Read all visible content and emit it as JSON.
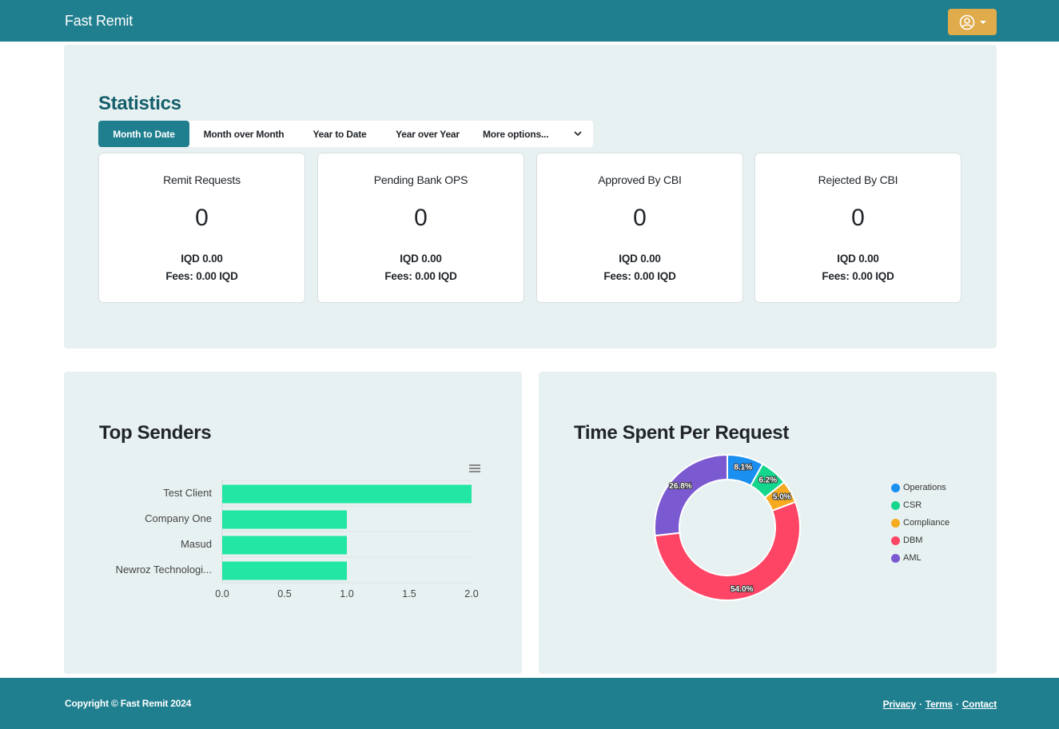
{
  "navbar": {
    "brand": "Fast Remit",
    "user_menu_icon": "user-circle-icon",
    "accent_color": "#1f7f8f",
    "button_color": "#dfab4b"
  },
  "statistics": {
    "title": "Statistics",
    "tabs": [
      {
        "label": "Month to Date",
        "active": true
      },
      {
        "label": "Month over Month",
        "active": false
      },
      {
        "label": "Year to Date",
        "active": false
      },
      {
        "label": "Year over Year",
        "active": false
      }
    ],
    "more_options": "More options...",
    "cards": [
      {
        "title": "Remit Requests",
        "count": "0",
        "amount": "IQD 0.00",
        "fees": "Fees: 0.00 IQD"
      },
      {
        "title": "Pending Bank OPS",
        "count": "0",
        "amount": "IQD 0.00",
        "fees": "Fees: 0.00 IQD"
      },
      {
        "title": "Approved By CBI",
        "count": "0",
        "amount": "IQD 0.00",
        "fees": "Fees: 0.00 IQD"
      },
      {
        "title": "Rejected By CBI",
        "count": "0",
        "amount": "IQD 0.00",
        "fees": "Fees: 0.00 IQD"
      }
    ]
  },
  "top_senders": {
    "title": "Top Senders"
  },
  "time_spent": {
    "title": "Time Spent Per Request"
  },
  "chart_data": [
    {
      "type": "bar",
      "orientation": "horizontal",
      "categories": [
        "Test Client",
        "Company One",
        "Masud",
        "Newroz Technologi..."
      ],
      "values": [
        2,
        1,
        1,
        1
      ],
      "xlim": [
        0,
        2
      ],
      "xticks": [
        "0.0",
        "0.5",
        "1.0",
        "1.5",
        "2.0"
      ],
      "color": "#22e6a3",
      "grid": true,
      "legend": false
    },
    {
      "type": "pie",
      "donut": true,
      "labels": [
        "Operations",
        "CSR",
        "Compliance",
        "DBM",
        "AML"
      ],
      "values": [
        8.1,
        6.2,
        5.0,
        54.0,
        26.8
      ],
      "data_labels": [
        "8.1%",
        "6.2%",
        "5.0%",
        "54.0%",
        "26.8%"
      ],
      "colors": [
        "#1a8ff0",
        "#14d68c",
        "#f5aa1f",
        "#ff4565",
        "#7b59d1"
      ],
      "legend_position": "right"
    }
  ],
  "footer": {
    "copyright": "Copyright © Fast Remit 2024",
    "links": [
      "Privacy",
      "Terms",
      "Contact"
    ],
    "separator": "·"
  }
}
